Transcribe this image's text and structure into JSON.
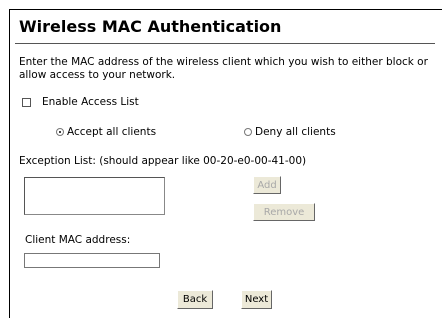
{
  "page": {
    "title": "Wireless MAC Authentication",
    "description": "Enter the MAC address of the wireless client which you wish to either block or allow access to your network."
  },
  "access_list": {
    "enable_label": "Enable Access List",
    "enabled": false
  },
  "client_policy": {
    "accept_label": "Accept all clients",
    "deny_label": "Deny all clients",
    "selected": "accept"
  },
  "exception_list": {
    "label": "Exception List: (should appear like 00-20-e0-00-41-00)",
    "entries": [],
    "add_label": "Add",
    "remove_label": "Remove"
  },
  "client_mac": {
    "label": "Client MAC address:",
    "value": ""
  },
  "navigation": {
    "back_label": "Back",
    "next_label": "Next"
  }
}
